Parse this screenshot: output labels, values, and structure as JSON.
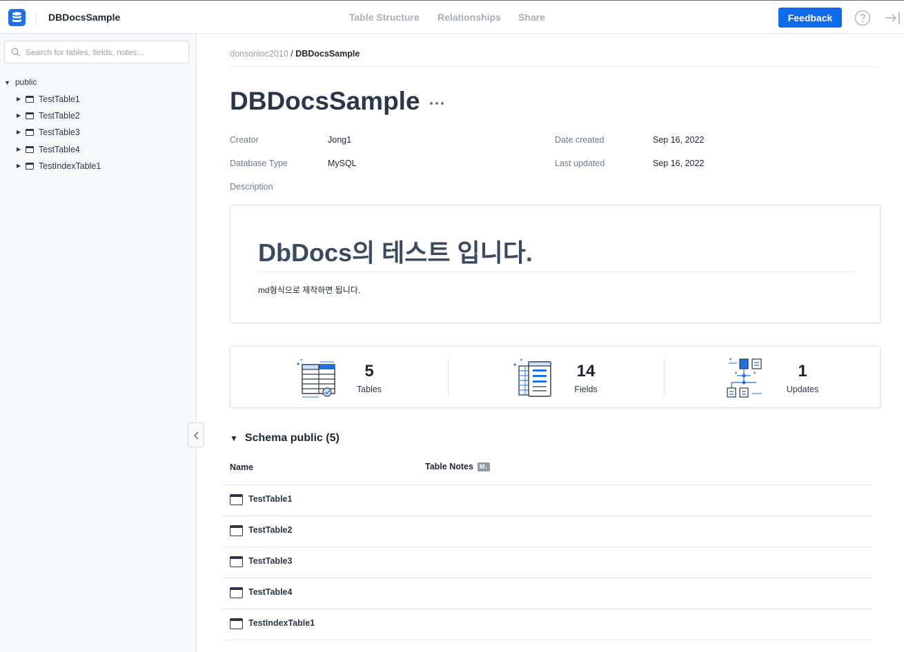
{
  "app": {
    "title": "DBDocsSample"
  },
  "nav": {
    "items": [
      "Table Structure",
      "Relationships",
      "Share"
    ]
  },
  "header": {
    "feedback_label": "Feedback"
  },
  "sidebar": {
    "search_placeholder": "Search for tables, fields, notes...",
    "schema": "public",
    "tables": [
      "TestTable1",
      "TestTable2",
      "TestTable3",
      "TestTable4",
      "TestIndexTable1"
    ]
  },
  "breadcrumb": {
    "owner": "donsonioc2010",
    "separator": " / ",
    "project": "DBDocsSample"
  },
  "page": {
    "title": "DBDocsSample"
  },
  "meta": {
    "creator_label": "Creator",
    "creator": "Jong1",
    "db_type_label": "Database Type",
    "db_type": "MySQL",
    "date_created_label": "Date created",
    "date_created": "Sep 16, 2022",
    "last_updated_label": "Last updated",
    "last_updated": "Sep 16, 2022",
    "description_label": "Description"
  },
  "description": {
    "heading": "DbDocs의 테스트 입니다.",
    "body": "md형식으로 제작하면 됩니다."
  },
  "stats": [
    {
      "value": "5",
      "label": "Tables",
      "icon": "tables-icon"
    },
    {
      "value": "14",
      "label": "Fields",
      "icon": "fields-icon"
    },
    {
      "value": "1",
      "label": "Updates",
      "icon": "updates-icon"
    }
  ],
  "schema_section": {
    "title": "Schema public (5)",
    "col_name": "Name",
    "col_notes": "Table Notes",
    "md_badge": "M↓",
    "rows": [
      "TestTable1",
      "TestTable2",
      "TestTable3",
      "TestTable4",
      "TestIndexTable1"
    ]
  },
  "colors": {
    "accent": "#0f6bea",
    "text": "#2b3648",
    "muted": "#6f7c8f"
  }
}
